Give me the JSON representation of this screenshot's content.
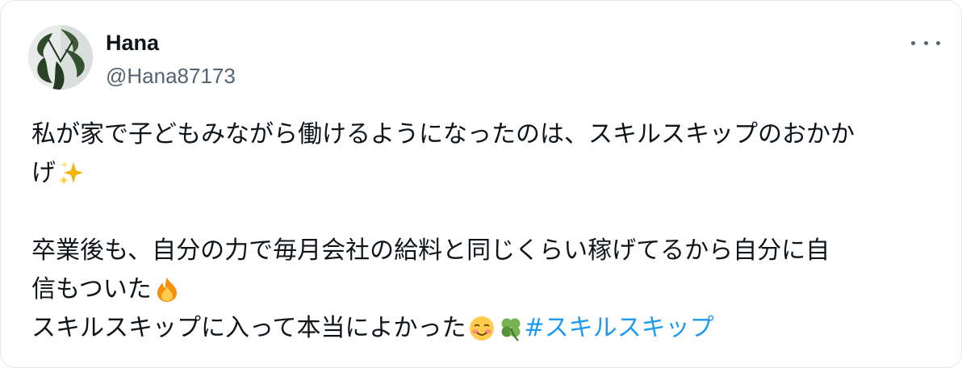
{
  "user": {
    "name": "Hana",
    "handle": "@Hana87173"
  },
  "tweet": {
    "line1": "私が家で子どもみながら働けるようになったのは、スキルスキップのおかか",
    "line2": "げ",
    "line3": "卒業後も、自分の力で毎月会社の給料と同じくらい稼げてるから自分に自",
    "line4": "信もついた",
    "line5": "スキルスキップに入って本当によかった",
    "hashtag": "#スキルスキップ"
  },
  "icons": {
    "avatar": "plant-avatar",
    "more": "more-options-icon",
    "emoji1": "sparkles-emoji",
    "emoji2": "fire-emoji",
    "emoji3": "smiling-face-emoji",
    "emoji4": "four-leaf-clover-emoji"
  },
  "colors": {
    "text": "#0f1419",
    "secondary": "#536471",
    "link": "#1d9bf0"
  }
}
